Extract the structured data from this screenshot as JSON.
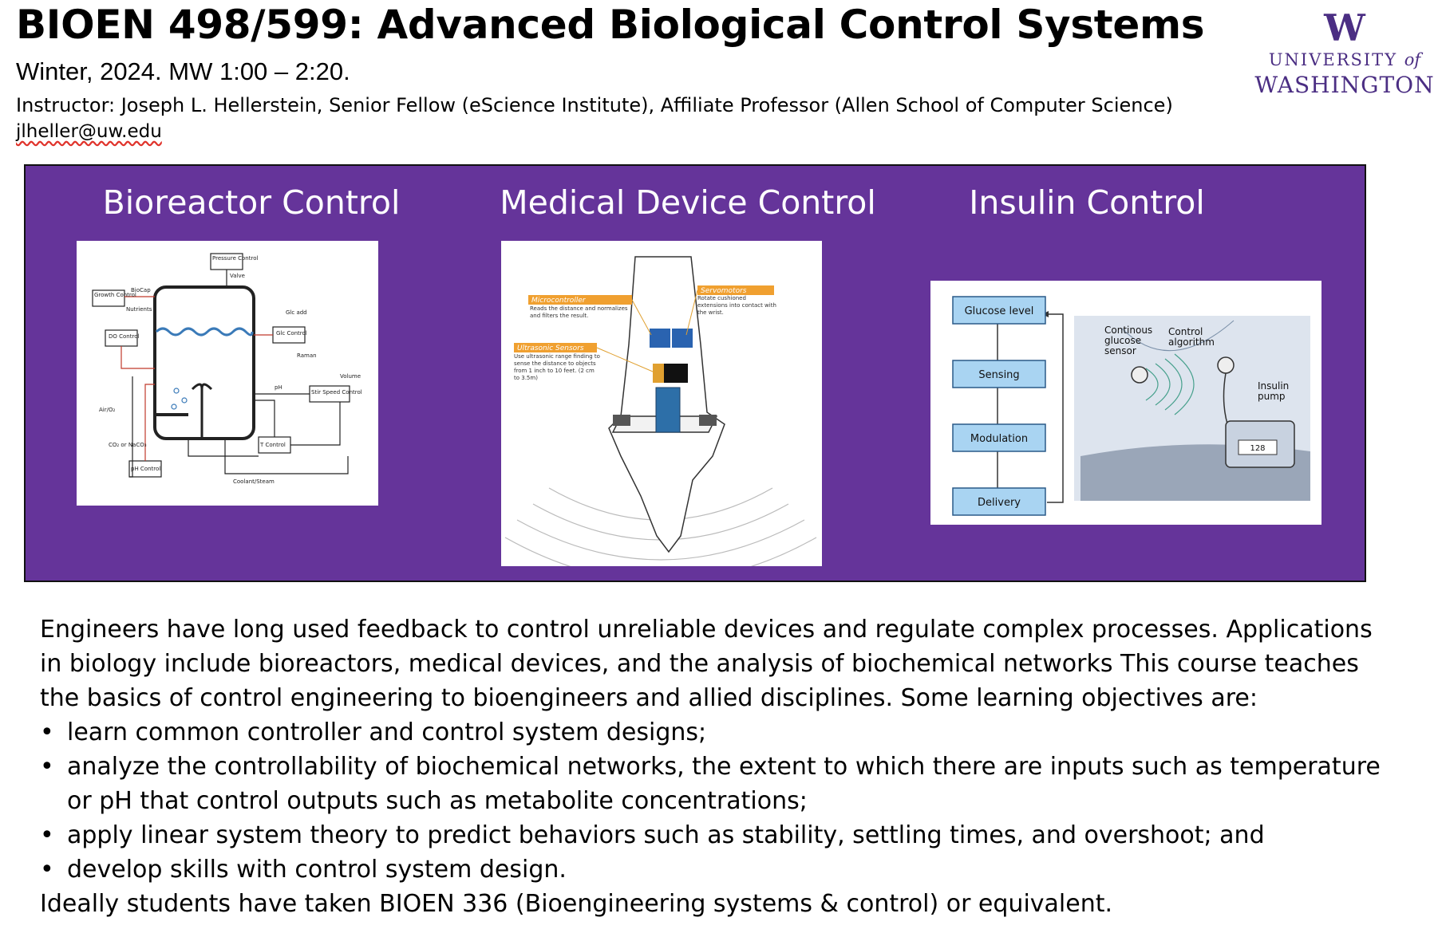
{
  "header": {
    "title": "BIOEN 498/599: Advanced Biological Control Systems",
    "subtitle": "Winter, 2024. MW 1:00 – 2:20.",
    "instructor": "Instructor: Joseph L. Hellerstein, Senior Fellow (eScience Institute), Affiliate Professor (Allen School of Computer Science)",
    "email": "jlheller@uw.edu"
  },
  "logo": {
    "mark": "W",
    "line1": "UNIVERSITY",
    "of": "of",
    "line2": "WASHINGTON",
    "color": "#4b2e83"
  },
  "banner": {
    "background": "#65349a",
    "panels": [
      {
        "title": "Bioreactor Control",
        "diagram_labels": {
          "pressure": "Pressure Control",
          "valve": "Valve",
          "growth": "Growth Control",
          "biocap": "BioCap",
          "nutrients": "Nutrients",
          "do": "DO Control",
          "glc_add": "Glc add",
          "glc": "Glc Control",
          "raman": "Raman",
          "volume": "Volume",
          "ph_label": "pH",
          "stir": "Stir Speed Control",
          "air": "Air/O₂",
          "t_control": "T Control",
          "co2": "CO₂ or NaCO₃",
          "ph_control": "pH Control",
          "coolant": "Coolant/Steam"
        }
      },
      {
        "title": "Medical Device Control",
        "callouts": [
          {
            "heading": "Microcontroller",
            "text": "Reads the distance and normalizes and filters the result."
          },
          {
            "heading": "Servomotors",
            "text": "Rotate cushioned extensions into contact with the wrist."
          },
          {
            "heading": "Ultrasonic Sensors",
            "text": "Use ultrasonic range finding to sense the distance to objects from 1 inch to 10 feet. (2 cm to 3.5m)"
          }
        ]
      },
      {
        "title": "Insulin Control",
        "flow": [
          "Glucose level",
          "Sensing",
          "Modulation",
          "Delivery"
        ],
        "labels": {
          "cgm": "Continous glucose sensor",
          "algorithm": "Control algorithm",
          "pump": "Insulin pump",
          "pump_display": "128"
        }
      }
    ]
  },
  "description": {
    "intro": "Engineers have long used feedback to control unreliable devices and regulate complex processes. Applications in biology include bioreactors, medical devices, and the analysis of biochemical networks This course teaches the basics of control engineering to bioengineers and allied disciplines. Some learning objectives are:",
    "bullet_symbol": "•",
    "objectives": [
      "learn common controller and control system designs;",
      "analyze the controllability of biochemical networks, the extent to which there are inputs such as temperature or pH that control outputs such as metabolite concentrations;",
      "apply linear system theory to predict behaviors such as stability, settling times, and overshoot; and",
      "develop skills with control system design."
    ],
    "prereq": "Ideally students have taken BIOEN 336 (Bioengineering systems & control) or equivalent."
  }
}
